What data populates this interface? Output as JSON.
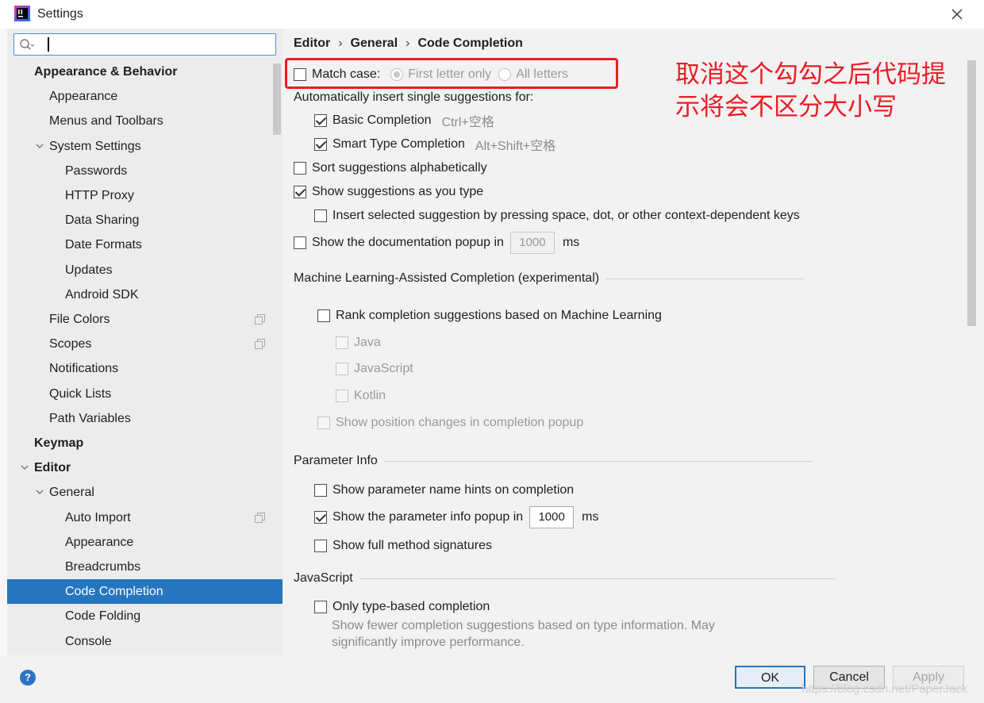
{
  "window": {
    "title": "Settings"
  },
  "sidebar": {
    "search_value": "",
    "items": [
      {
        "label": "Appearance & Behavior",
        "level": 0,
        "bold": true
      },
      {
        "label": "Appearance",
        "level": 1
      },
      {
        "label": "Menus and Toolbars",
        "level": 1
      },
      {
        "label": "System Settings",
        "level": 1,
        "expanded": true
      },
      {
        "label": "Passwords",
        "level": 2
      },
      {
        "label": "HTTP Proxy",
        "level": 2
      },
      {
        "label": "Data Sharing",
        "level": 2
      },
      {
        "label": "Date Formats",
        "level": 2
      },
      {
        "label": "Updates",
        "level": 2
      },
      {
        "label": "Android SDK",
        "level": 2
      },
      {
        "label": "File Colors",
        "level": 1,
        "copy_icon": true
      },
      {
        "label": "Scopes",
        "level": 1,
        "copy_icon": true
      },
      {
        "label": "Notifications",
        "level": 1
      },
      {
        "label": "Quick Lists",
        "level": 1
      },
      {
        "label": "Path Variables",
        "level": 1
      },
      {
        "label": "Keymap",
        "level": 0,
        "bold": true
      },
      {
        "label": "Editor",
        "level": 0,
        "bold": true,
        "expanded": true
      },
      {
        "label": "General",
        "level": 1,
        "expanded": true
      },
      {
        "label": "Auto Import",
        "level": 2,
        "copy_icon": true
      },
      {
        "label": "Appearance",
        "level": 2
      },
      {
        "label": "Breadcrumbs",
        "level": 2
      },
      {
        "label": "Code Completion",
        "level": 2,
        "selected": true
      },
      {
        "label": "Code Folding",
        "level": 2
      },
      {
        "label": "Console",
        "level": 2
      }
    ]
  },
  "breadcrumb": [
    "Editor",
    "General",
    "Code Completion"
  ],
  "breadcrumb_sep": "›",
  "options": {
    "match_case": {
      "label": "Match case:",
      "checked": false
    },
    "first_letter_only": {
      "label": "First letter only",
      "checked": true
    },
    "all_letters": {
      "label": "All letters",
      "checked": false
    },
    "auto_insert_heading": "Automatically insert single suggestions for:",
    "basic_completion": {
      "label": "Basic Completion",
      "shortcut": "Ctrl+空格",
      "checked": true
    },
    "smart_type_completion": {
      "label": "Smart Type Completion",
      "shortcut": "Alt+Shift+空格",
      "checked": true
    },
    "sort_alpha": {
      "label": "Sort suggestions alphabetically",
      "checked": false
    },
    "show_as_you_type": {
      "label": "Show suggestions as you type",
      "checked": true
    },
    "insert_selected": {
      "label": "Insert selected suggestion by pressing space, dot, or other context-dependent keys",
      "checked": false
    },
    "doc_popup": {
      "label": "Show the documentation popup in",
      "value": "1000",
      "unit": "ms",
      "checked": false
    }
  },
  "ml_section": {
    "title": "Machine Learning-Assisted Completion (experimental)",
    "rank": {
      "label": "Rank completion suggestions based on Machine Learning",
      "checked": false
    },
    "languages": [
      "Java",
      "JavaScript",
      "Kotlin"
    ],
    "position_changes": "Show position changes in completion popup"
  },
  "param_section": {
    "title": "Parameter Info",
    "name_hints": {
      "label": "Show parameter name hints on completion",
      "checked": false
    },
    "info_popup": {
      "label": "Show the parameter info popup in",
      "value": "1000",
      "unit": "ms",
      "checked": true
    },
    "full_signatures": {
      "label": "Show full method signatures",
      "checked": false
    }
  },
  "js_section": {
    "title": "JavaScript",
    "only_type_based": {
      "label": "Only type-based completion",
      "checked": false
    },
    "description_line1": "Show fewer completion suggestions based on type information. May",
    "description_line2": "significantly improve performance."
  },
  "annotation": {
    "line1": "取消这个勾勾之后代码提",
    "line2": "示将会不区分大小写",
    "color": "#ec1c24"
  },
  "buttons": {
    "ok": "OK",
    "cancel": "Cancel",
    "apply": "Apply",
    "help": "?"
  },
  "watermark": "https://blog.csdn.net/PaperJack",
  "colors": {
    "selection": "#2675bf",
    "accent": "#2d74c4"
  }
}
